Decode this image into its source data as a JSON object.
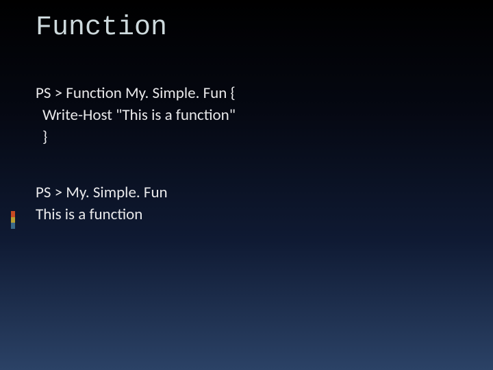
{
  "slide": {
    "title": "Function",
    "code": {
      "line1": "PS > Function My. Simple. Fun {",
      "line2": "Write-Host \"This is a function\"",
      "line3": "}"
    },
    "output": {
      "line1": "PS > My. Simple. Fun",
      "line2": "This is a function"
    }
  }
}
